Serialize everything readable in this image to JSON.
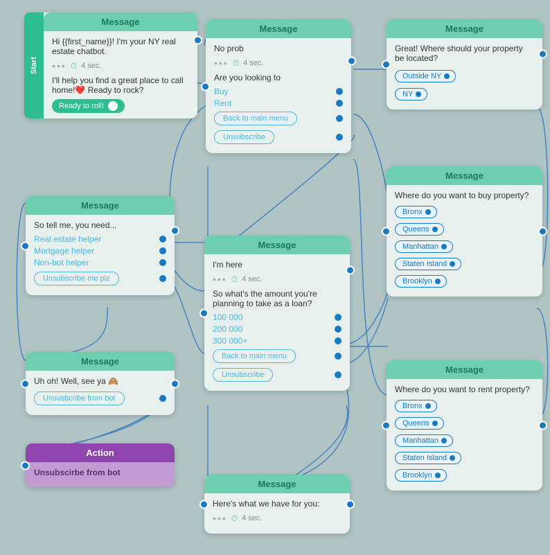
{
  "canvas": {
    "bg": "#b0c4c4"
  },
  "nodes": {
    "start": {
      "header": "Message",
      "badge": "Start",
      "msg1": "Hi {{first_name}}! I'm your NY real estate chatbot.",
      "meta1": "4 sec.",
      "msg2": "I'll help you find a great place to call home!❤️\nReady to rock?",
      "btn": "Ready to roll!"
    },
    "n2": {
      "header": "Message",
      "msg1": "No prob",
      "meta1": "4 sec.",
      "msg2": "Are you looking to",
      "choices": [
        "Buy",
        "Rent"
      ],
      "btns": [
        "Back to main menu",
        "Unsubscribe"
      ]
    },
    "n3": {
      "header": "Message",
      "msg1": "Great! Where should your property be located?",
      "choices": [
        "Outside NY",
        "NY"
      ]
    },
    "n4": {
      "header": "Message",
      "msg1": "So tell me, you need...",
      "choices": [
        "Real estate helper",
        "Mortgage helper",
        "Non-bot helper"
      ],
      "btn": "Unsubscribe me plz"
    },
    "n5": {
      "header": "Message",
      "msg1": "I'm here",
      "meta1": "4 sec.",
      "msg2": "So what's the amount you're planning to take as a loan?",
      "choices": [
        "100 000",
        "200 000",
        "300 000+"
      ],
      "btns": [
        "Back to main menu",
        "Unsubscribe"
      ]
    },
    "n6": {
      "header": "Message",
      "msg1": "Uh oh! Well, see ya 🙈",
      "btn": "Unsusbcribe from bot"
    },
    "n7": {
      "header": "Action",
      "msg1": "Unsubscirbe from bot"
    },
    "n8": {
      "header": "Message",
      "msg1": "Where do you want to buy property?",
      "choices": [
        "Bronx",
        "Queens",
        "Manhattan",
        "Staten Island",
        "Brooklyn"
      ]
    },
    "n9": {
      "header": "Message",
      "msg1": "Where do you want to rent property?",
      "choices": [
        "Bronx",
        "Queens",
        "Manhattan",
        "Staten Island",
        "Brooklyn"
      ]
    },
    "n10": {
      "header": "Message",
      "msg1": "Here's what we have for you:",
      "meta1": "4 sec."
    }
  }
}
